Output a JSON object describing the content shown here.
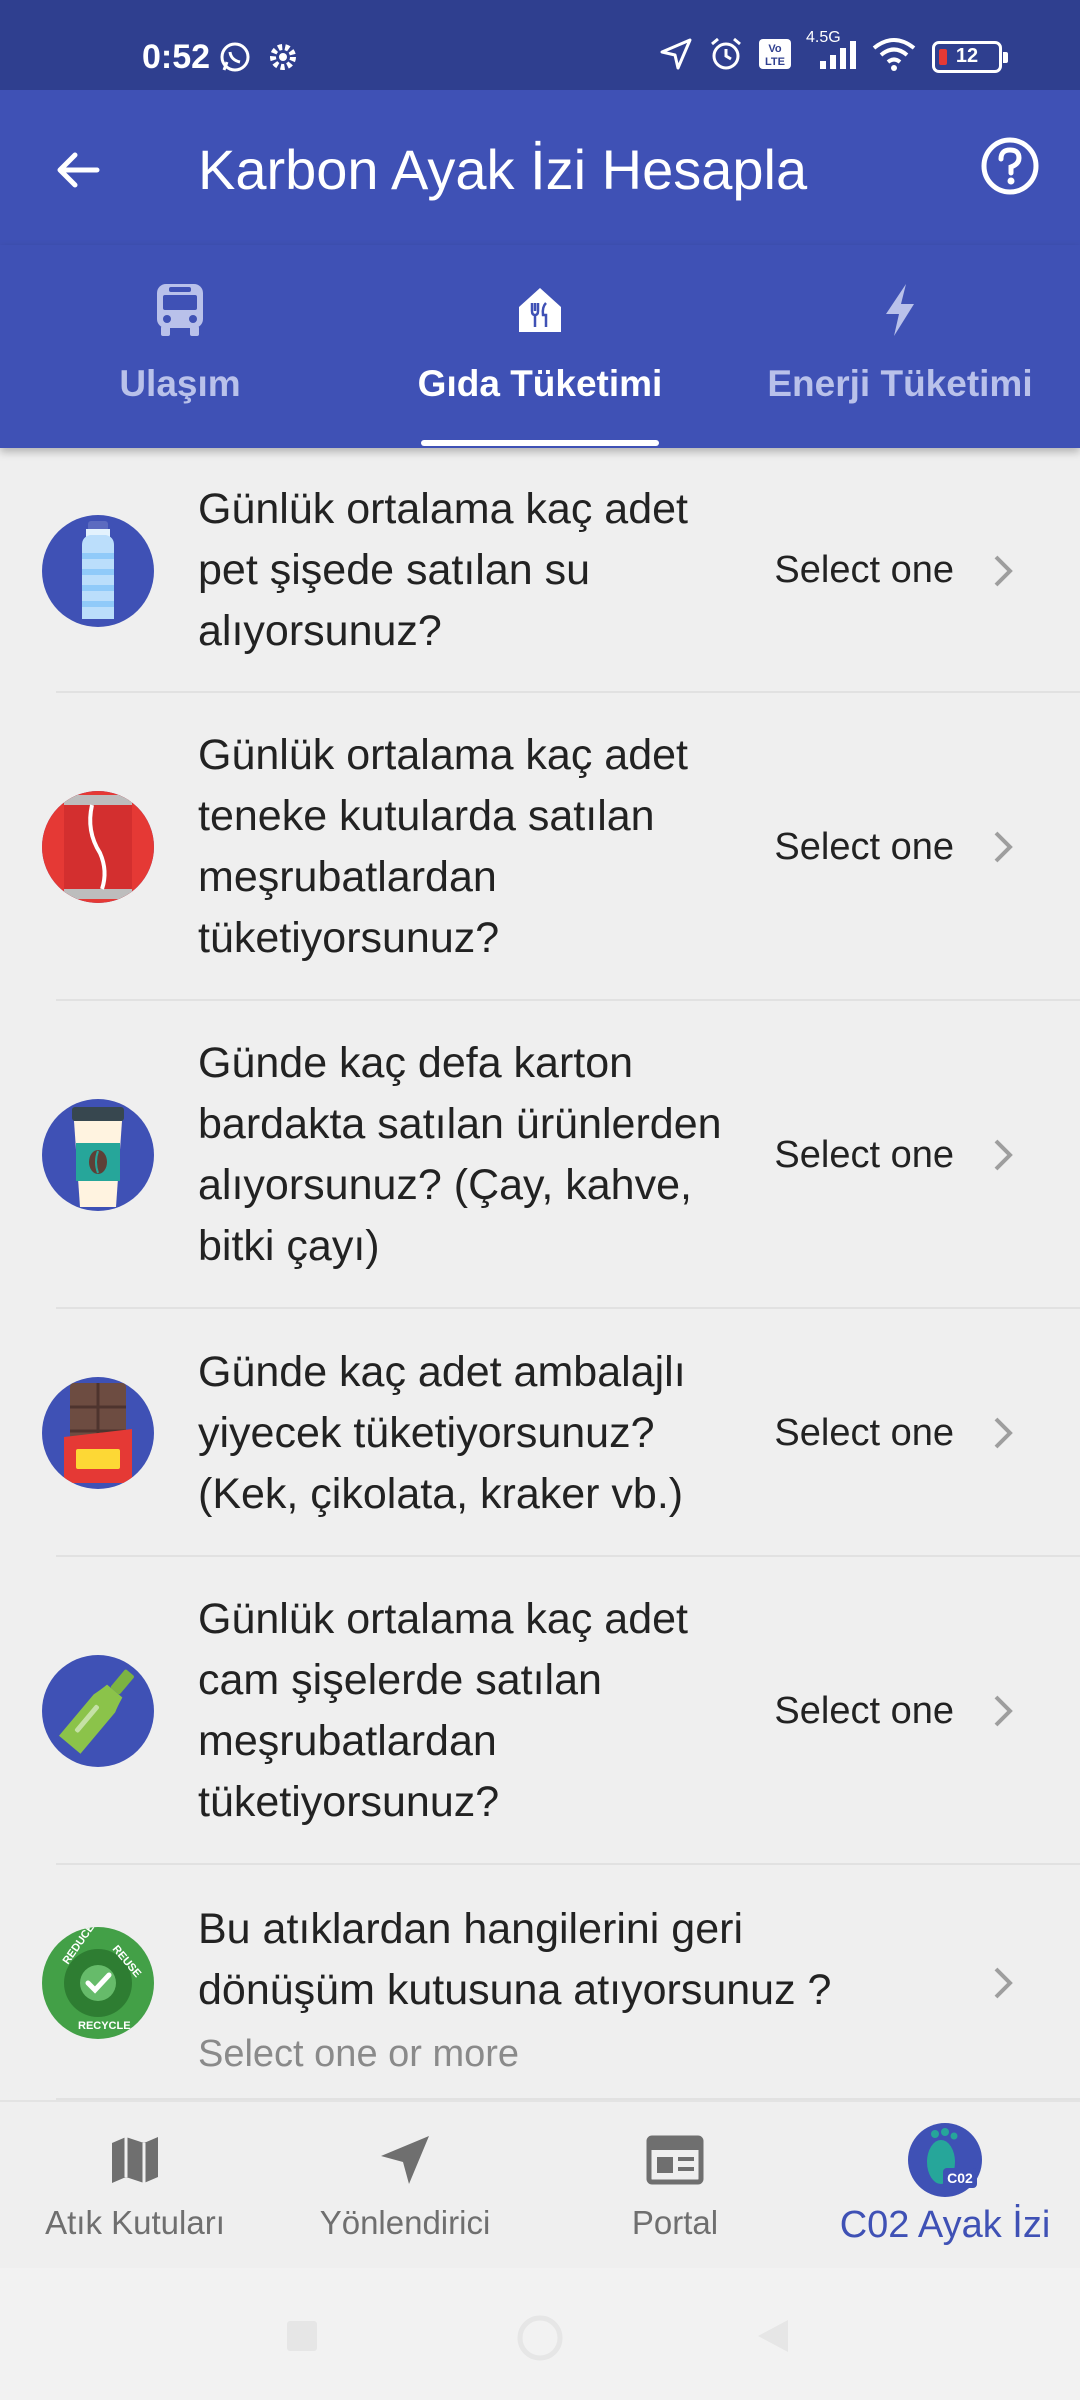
{
  "status_bar": {
    "time": "0:52",
    "battery": "12",
    "network": "4.5G"
  },
  "app_bar": {
    "title": "Karbon Ayak İzi Hesapla"
  },
  "tabs": [
    {
      "label": "Ulaşım",
      "icon": "bus-icon",
      "active": false
    },
    {
      "label": "Gıda Tüketimi",
      "icon": "restaurant-icon",
      "active": true
    },
    {
      "label": "Enerji Tüketimi",
      "icon": "bolt-icon",
      "active": false
    }
  ],
  "questions": [
    {
      "text": "Günlük ortalama kaç adet pet şişede satılan su alıyorsunuz?",
      "value": "Select one",
      "icon": "water-bottle-icon"
    },
    {
      "text": "Günlük ortalama kaç adet teneke kutularda satılan meşrubatlardan tüketiyorsunuz?",
      "value": "Select one",
      "icon": "soda-can-icon"
    },
    {
      "text": "Günde kaç defa karton bardakta satılan ürünlerden alıyorsunuz? (Çay, kahve, bitki çayı)",
      "value": "Select one",
      "icon": "coffee-cup-icon"
    },
    {
      "text": "Günde kaç adet ambalajlı yiyecek tüketiyorsunuz? (Kek, çikolata, kraker vb.)",
      "value": "Select one",
      "icon": "chocolate-bar-icon"
    },
    {
      "text": "Günlük ortalama kaç adet cam şişelerde satılan meşrubatlardan tüketiyorsunuz?",
      "value": "Select one",
      "icon": "glass-bottle-icon"
    }
  ],
  "recycle_question": {
    "text": "Bu atıklardan hangilerini geri dönüşüm kutusuna atıyorsunuz ?",
    "hint": "Select one or more",
    "badge_top_left": "REDUCE",
    "badge_top_right": "REUSE",
    "badge_bottom": "RECYCLE"
  },
  "bottom_nav": [
    {
      "label": "Atık Kutuları",
      "icon": "map-icon",
      "active": false
    },
    {
      "label": "Yönlendirici",
      "icon": "navigation-icon",
      "active": false
    },
    {
      "label": "Portal",
      "icon": "portal-icon",
      "active": false
    },
    {
      "label": "C02 Ayak İzi",
      "icon": "co2-footprint-icon",
      "active": true,
      "badge": "C02"
    }
  ],
  "colors": {
    "primary": "#3f51b5",
    "status_bar": "#2f3f8f",
    "background": "#efefef",
    "inactive_tab": "#b9c1ea"
  }
}
